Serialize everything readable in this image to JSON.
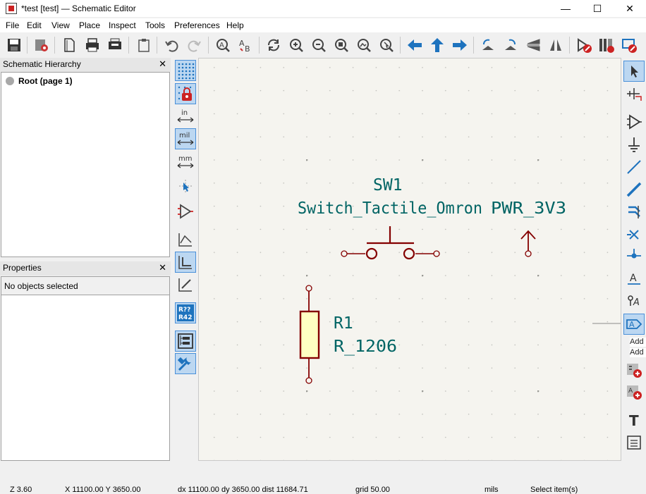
{
  "window": {
    "title": "*test [test] — Schematic Editor",
    "minimize": "—",
    "maximize": "☐",
    "close": "✕"
  },
  "menu": [
    "File",
    "Edit",
    "View",
    "Place",
    "Inspect",
    "Tools",
    "Preferences",
    "Help"
  ],
  "hierarchy": {
    "title": "Schematic Hierarchy",
    "close": "✕",
    "root_item": "Root (page 1)"
  },
  "properties": {
    "title": "Properties",
    "close": "✕",
    "empty_text": "No objects selected"
  },
  "left_tools": {
    "unit_in": "in",
    "unit_mil": "mil",
    "unit_mm": "mm",
    "annotate_top": "R??",
    "annotate_bottom": "R42"
  },
  "schematic": {
    "switch_ref": "SW1",
    "switch_value": "Switch_Tactile_Omron",
    "power_value": "PWR_3V3",
    "resistor_ref": "R1",
    "resistor_value": "R_1206"
  },
  "right_tools": {
    "label_a": "A",
    "text_t": "T",
    "tooltip_line1": "Add",
    "tooltip_line2": "Add"
  },
  "status": {
    "zoom": "Z 3.60",
    "cursor": "X 11100.00  Y 3650.00",
    "delta": "dx 11100.00  dy 3650.00  dist 11684.71",
    "grid": "grid 50.00",
    "units": "mils",
    "mode": "Select item(s)"
  },
  "colors": {
    "symbol": "#840000",
    "body_fill": "#ffffc2",
    "text": "#006464",
    "canvas": "#f5f4ef",
    "accent": "#1e73be"
  }
}
